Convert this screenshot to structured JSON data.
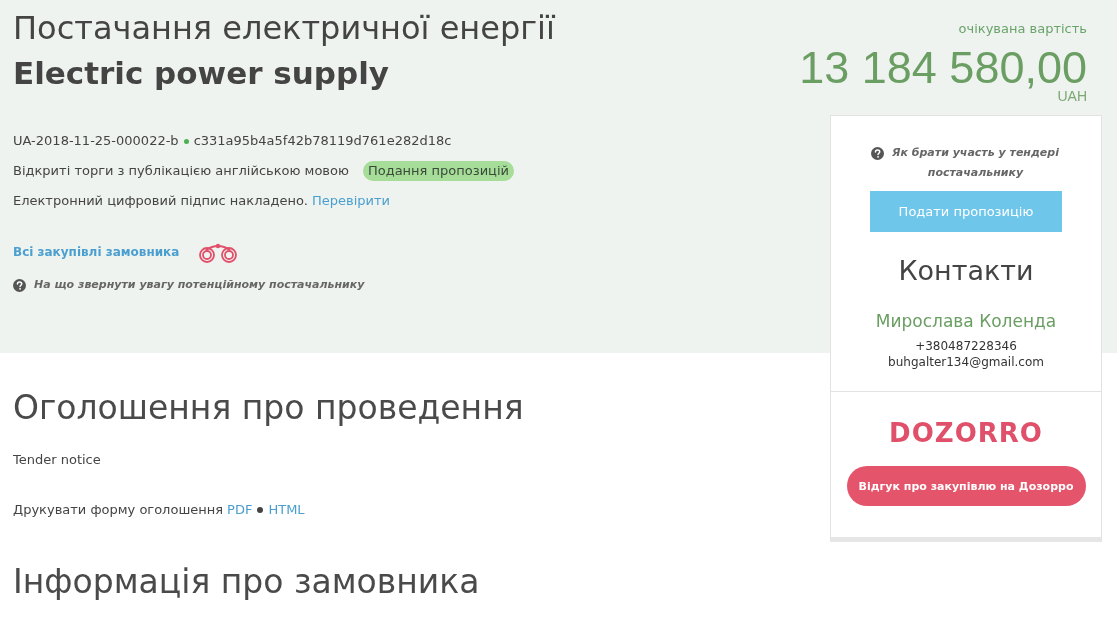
{
  "header": {
    "title_local": "Постачання електричної енергії",
    "title_en": "Electric power supply",
    "tender_id": "UA-2018-11-25-000022-b",
    "hash": "c331a95b4a5f42b78119d761e282d18c",
    "procedure": "Відкриті торги з публікацією англійською мовою",
    "status_badge": "Подання пропозицій",
    "signature_text": "Електронний цифровий підпис накладено.",
    "signature_link": "Перевірити",
    "buyer_link": "Всі закупівлі замовника",
    "hint_link": "На що звернути увагу потенційному постачальнику"
  },
  "value": {
    "label": "очікувана вартість",
    "amount": "13 184 580,00",
    "currency": "UAH"
  },
  "sidebar": {
    "help_link": "Як брати участь у тендері постачальнику",
    "submit_button": "Подати пропозицію",
    "contacts_title": "Контакти",
    "contact_name": "Мирослава Коленда",
    "phone": "+380487228346",
    "email": "buhgalter134@gmail.com",
    "logo": "DOZORRO",
    "feedback_button": "Відгук про закупівлю на Дозорро"
  },
  "sections": [
    {
      "heading": "Оголошення про проведення",
      "subtitle": "Tender notice",
      "print_label": "Друкувати форму оголошення",
      "print_links": [
        "PDF",
        "HTML"
      ]
    },
    {
      "heading": "Інформація про замовника"
    }
  ]
}
